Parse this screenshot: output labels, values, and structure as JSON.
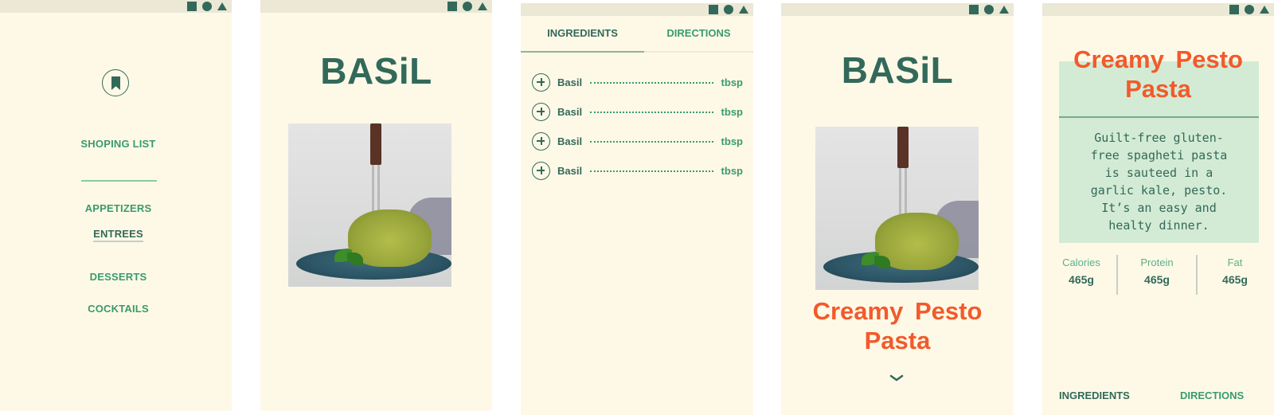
{
  "colors": {
    "background": "#fef9e7",
    "status_bar": "#ebe8d6",
    "primary_dark_green": "#33695a",
    "accent_green": "#3a9a6e",
    "title_orange": "#f25a2b",
    "description_bg": "#d3ebd4"
  },
  "status_bar": {
    "icons": [
      "square-icon",
      "circle-icon",
      "triangle-icon"
    ]
  },
  "screen1": {
    "bookmark_icon": "bookmark-icon",
    "shopping_list": "SHOPING LIST",
    "categories": [
      {
        "label": "APPETIZERS",
        "active": false
      },
      {
        "label": "ENTREES",
        "active": true
      },
      {
        "label": "DESSERTS",
        "active": false
      },
      {
        "label": "COCKTAILS",
        "active": false
      }
    ]
  },
  "screen2": {
    "logo": "BASiL",
    "image_alt": "Spaghetti with pesto twirled on a fork over a blue plate"
  },
  "screen3": {
    "tabs": [
      {
        "label": "INGREDIENTS",
        "active": true
      },
      {
        "label": "DIRECTIONS",
        "active": false
      }
    ],
    "ingredients": [
      {
        "name": "Basil",
        "unit": "tbsp"
      },
      {
        "name": "Basil",
        "unit": "tbsp"
      },
      {
        "name": "Basil",
        "unit": "tbsp"
      },
      {
        "name": "Basil",
        "unit": "tbsp"
      }
    ]
  },
  "screen4": {
    "logo": "BASiL",
    "title_line1": "Creamy Pesto",
    "title_line2": "Pasta",
    "scroll_icon": "chevron-down-icon"
  },
  "screen5": {
    "title_line1": "Creamy Pesto",
    "title_line2": "Pasta",
    "description": "Guilt-free gluten-\nfree spagheti pasta\nis sauteed in a\ngarlic kale, pesto.\nIt’s an easy and\nhealty dinner.",
    "nutrition": [
      {
        "label": "Calories",
        "value": "465g"
      },
      {
        "label": "Protein",
        "value": "465g"
      },
      {
        "label": "Fat",
        "value": "465g"
      }
    ],
    "tabs": [
      {
        "label": "INGREDIENTS"
      },
      {
        "label": "DIRECTIONS"
      }
    ]
  }
}
